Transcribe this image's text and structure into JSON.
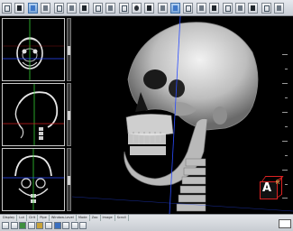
{
  "toolbar": {
    "buttons": [
      "layout",
      "zoom",
      "window-level",
      "pan",
      "rotate",
      "measure",
      "roi",
      "annotate",
      "cine",
      "slab",
      "mip",
      "volume-render",
      "mpr",
      "cut",
      "reset",
      "filters",
      "bone",
      "skin",
      "brightness",
      "cursor",
      "cross",
      "sync",
      "crop",
      "export",
      "print",
      "save",
      "tools",
      "help"
    ],
    "active_index": 13
  },
  "left_panel": {
    "viewports": [
      "axial",
      "sagittal",
      "coronal"
    ]
  },
  "main_view": {
    "orientation_cube_letter": "A",
    "orientation_cube_side_letter": "R"
  },
  "status_bar": {
    "tabs": [
      "Display",
      "Lut",
      "Clrlt",
      "Pipe",
      "Window-Level",
      "Mode",
      "Zoo",
      "Image",
      "Scroll"
    ]
  },
  "colors": {
    "crosshair_green": "#33cc33",
    "crosshair_red": "#d11e1e",
    "crosshair_blue": "#2a4cff",
    "bone": "#e8e8e8"
  }
}
